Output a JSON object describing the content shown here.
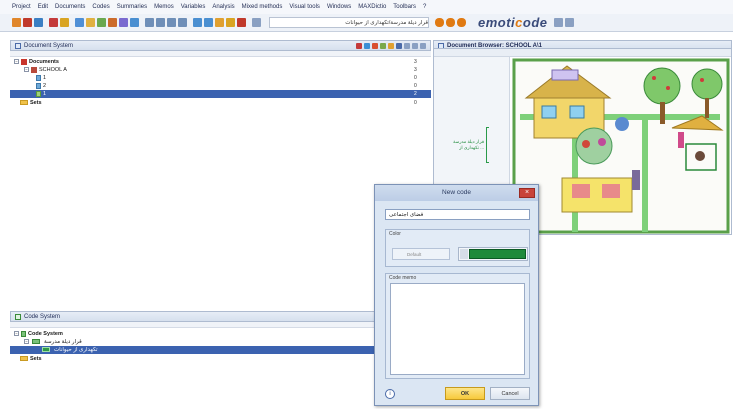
{
  "menu": [
    "Project",
    "Edit",
    "Documents",
    "Codes",
    "Summaries",
    "Memos",
    "Variables",
    "Analysis",
    "Mixed methods",
    "Visual tools",
    "Windows",
    "MAXDictio",
    "Toolbars",
    "?"
  ],
  "toolbar": {
    "doc_select_value": "قرار دیلة مدرسة/تکهداری از حیوانات",
    "brand_main": "emoti",
    "brand_accent": "c",
    "brand_end": "ode"
  },
  "document_system": {
    "title": "Document System",
    "items": [
      {
        "label": "Documents",
        "count": "3"
      },
      {
        "label": "SCHOOL A",
        "count": "3"
      },
      {
        "label": "1",
        "count": "0"
      },
      {
        "label": "2",
        "count": "0"
      },
      {
        "label": "1",
        "count": "2"
      },
      {
        "label": "Sets",
        "count": "0"
      }
    ]
  },
  "document_browser": {
    "title": "Document Browser: SCHOOL A\\1",
    "margin_code_1": "قرار دیلة مدرسة",
    "margin_code_2": "تکهداری از ..."
  },
  "code_system": {
    "title": "Code System",
    "items": [
      {
        "label": "Code System"
      },
      {
        "label": "قرار دیلة مدرسة"
      },
      {
        "label": "تکهداری از حیوانات"
      },
      {
        "label": "Sets"
      }
    ]
  },
  "dialog": {
    "title": "New code",
    "name_value": "فضای اجتماعی",
    "color_label": "Color",
    "default_label": "Default",
    "color_value": "#1f8a3b",
    "memo_label": "Code memo",
    "ok_label": "OK",
    "cancel_label": "Cancel",
    "info_glyph": "i"
  },
  "colors": {
    "selection": "#3b62b0",
    "code_green": "#1f8a3b"
  }
}
